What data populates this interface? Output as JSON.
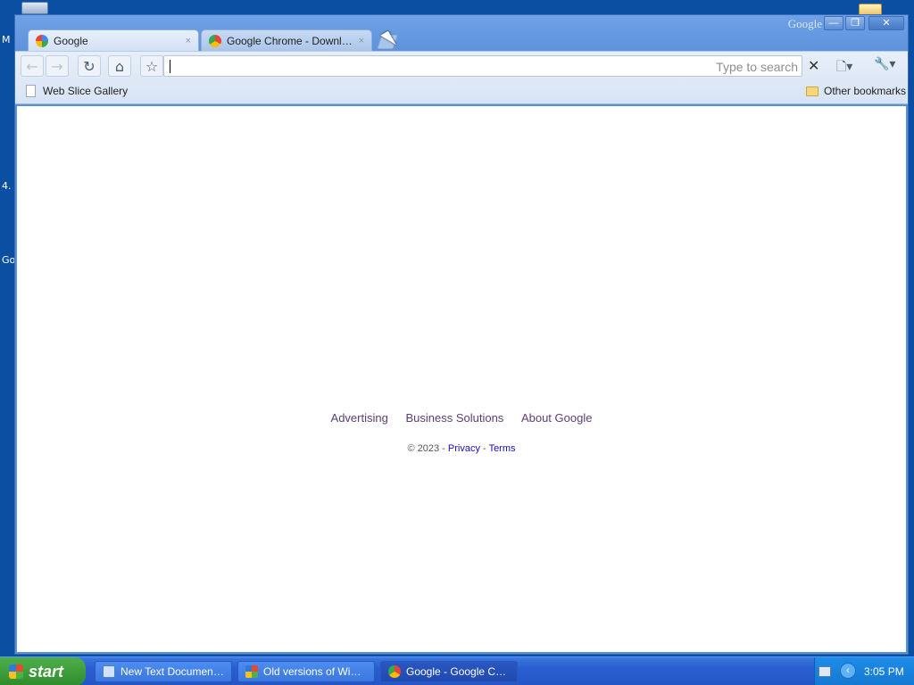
{
  "desktop": {
    "fragments": [
      "M",
      "4.",
      "Go"
    ]
  },
  "window": {
    "brand": "Google",
    "controls": {
      "minimize": "—",
      "maximize": "❐",
      "close": "✕"
    }
  },
  "tabs": [
    {
      "title": "Google",
      "close": "×",
      "favicon": "google-g-icon",
      "active": true
    },
    {
      "title": "Google Chrome - Download...",
      "close": "×",
      "favicon": "chrome-icon",
      "active": false
    }
  ],
  "toolbar": {
    "back": "←",
    "forward": "→",
    "reload": "↻",
    "home": "⌂",
    "star": "☆",
    "omnibox_value": "",
    "omnibox_hint": "Type to search",
    "clear": "✕",
    "page_menu": "🗋▾",
    "wrench_menu": "🔧▾"
  },
  "bookmarks": {
    "left": "Web Slice Gallery",
    "right": "Other bookmarks"
  },
  "page": {
    "footer_links": [
      "Advertising",
      "Business Solutions",
      "About Google"
    ],
    "copyright": "© 2023 -",
    "privacy": "Privacy",
    "separator": "-",
    "terms": "Terms"
  },
  "taskbar": {
    "start": "start",
    "tasks": [
      {
        "label": "New Text Document -...",
        "icon": "notepad-icon",
        "active": false
      },
      {
        "label": "Old versions of Wind...",
        "icon": "window-icon",
        "active": false
      },
      {
        "label": "Google - Google Chrome",
        "icon": "chrome-icon",
        "active": true
      }
    ],
    "clock": "3:05 PM"
  },
  "colors": {
    "desktop": "#0b4fa3",
    "titlebar": "#5e93dc",
    "footer_link": "#5c3f72",
    "taskbar": "#2456c6",
    "start": "#2f8b2b"
  }
}
